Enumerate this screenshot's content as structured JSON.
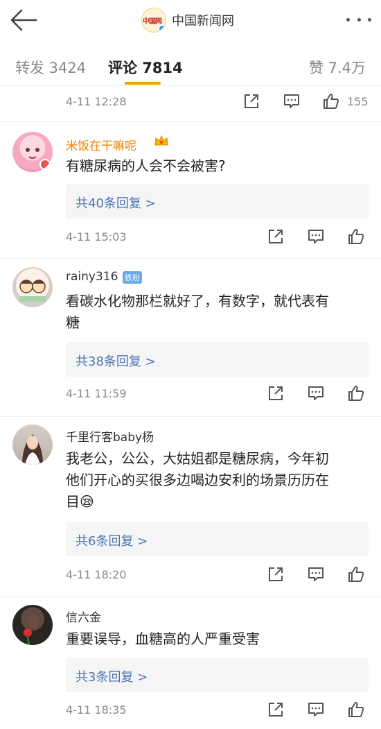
{
  "header": {
    "brand_logo_text": "中国网",
    "brand_name": "中国新闻网"
  },
  "tabs": {
    "repost": "转发 3424",
    "comment": "评论 7814",
    "like": "赞 7.4万"
  },
  "top_item": {
    "time": "4-11 12:28",
    "like_count": "155"
  },
  "comments": [
    {
      "user": "米饭在干嘛呢",
      "text_lines": [
        "有糖尿病的人会不会被害?"
      ],
      "replies": "共40条回复 >",
      "time": "4-11 15:03"
    },
    {
      "user": "rainy316",
      "badge": "铁粉",
      "text_lines": [
        "看碳水化物那栏就好了，有数字，就代表有",
        "糖"
      ],
      "replies": "共38条回复 >",
      "time": "4-11 11:59"
    },
    {
      "user": "千里行客baby杨",
      "text_lines": [
        "我老公，公公，大姑姐都是糖尿病，今年初",
        "他们开心的买很多边喝边安利的场景历历在",
        "目😪"
      ],
      "replies": "共6条回复 >",
      "time": "4-11 18:20"
    },
    {
      "user": "信六金",
      "text_lines": [
        "重要误导，血糖高的人严重受害"
      ],
      "replies": "共3条回复 >",
      "time": "4-11 18:35"
    }
  ],
  "colors": {
    "accent": "#f7a000",
    "username": "#f08000",
    "reply_link": "#4a74b4",
    "verified_badge": "#2b9af3"
  },
  "icons": [
    "back-arrow-icon",
    "more-dots-icon",
    "share-icon",
    "comment-icon",
    "thumbs-up-icon",
    "crown-icon",
    "verified-icon"
  ]
}
